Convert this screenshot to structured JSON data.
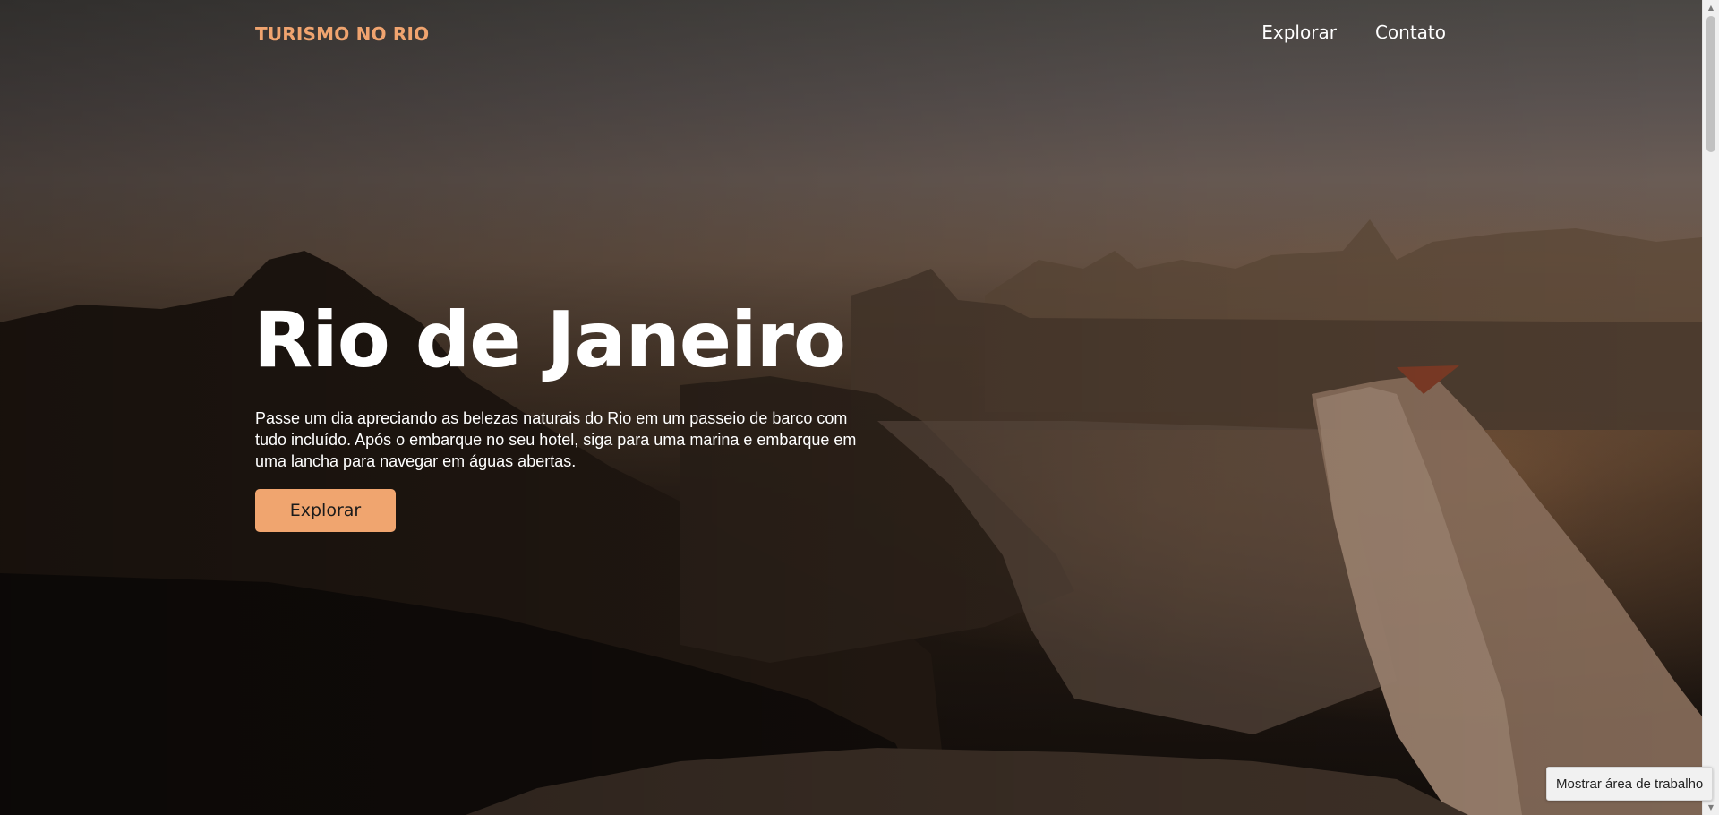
{
  "nav": {
    "brand": "TURISMO NO RIO",
    "links": [
      {
        "label": "Explorar"
      },
      {
        "label": "Contato"
      }
    ]
  },
  "hero": {
    "title": "Rio de Janeiro",
    "description": "Passe um dia apreciando as belezas naturais do Rio em um passeio de barco com tudo incluído. Após o embarque no seu hotel, siga para uma marina e embarque em uma lancha para navegar em águas abertas.",
    "cta_label": "Explorar"
  },
  "system": {
    "tooltip": "Mostrar área de trabalho",
    "scroll_up_glyph": "▲",
    "scroll_down_glyph": "▼"
  },
  "colors": {
    "accent": "#f0a56f",
    "text": "#ffffff"
  }
}
